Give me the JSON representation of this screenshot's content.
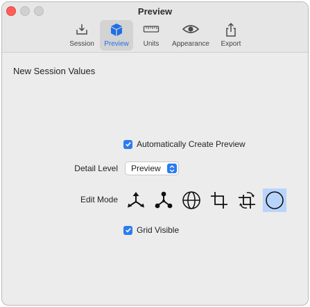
{
  "window": {
    "title": "Preview"
  },
  "toolbar": {
    "tabs": [
      {
        "label": "Session",
        "icon": "tray-download-icon"
      },
      {
        "label": "Preview",
        "icon": "cube-icon",
        "active": true
      },
      {
        "label": "Units",
        "icon": "ruler-icon"
      },
      {
        "label": "Appearance",
        "icon": "eye-icon"
      },
      {
        "label": "Export",
        "icon": "share-icon"
      }
    ]
  },
  "content": {
    "section_title": "New Session Values",
    "auto_preview": {
      "label": "Automatically Create Preview",
      "checked": true
    },
    "detail_level": {
      "label": "Detail Level",
      "value": "Preview"
    },
    "edit_mode": {
      "label": "Edit Mode",
      "modes": [
        "move-axes-icon",
        "joint-nodes-icon",
        "globe-icon",
        "crop-icon",
        "crop-rotate-icon",
        "circle-icon"
      ],
      "selected": "circle-icon"
    },
    "grid_visible": {
      "label": "Grid Visible",
      "checked": true
    }
  },
  "colors": {
    "accent": "#2a7cf1",
    "selected_bg": "#b9d4fb",
    "close": "#ff5f57"
  }
}
